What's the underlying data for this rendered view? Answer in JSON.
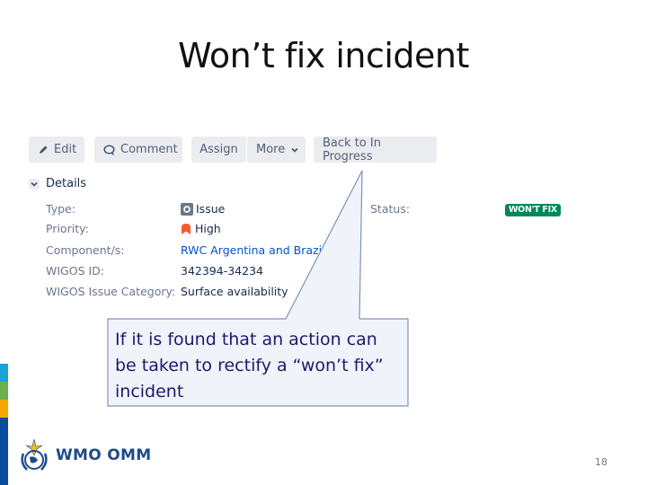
{
  "slide": {
    "title": "Won’t fix incident",
    "page_number": "18"
  },
  "toolbar": {
    "edit_label": "Edit",
    "comment_label": "Comment",
    "assign_label": "Assign",
    "more_label": "More",
    "back_label": "Back to In Progress"
  },
  "details": {
    "section_label": "Details",
    "fields": [
      {
        "label": "Type:",
        "value": "Issue",
        "icon": "issue-type-icon"
      },
      {
        "label": "Priority:",
        "value": "High",
        "icon": "priority-high-icon"
      },
      {
        "label": "Component/s:",
        "value": "RWC Argentina and Brazil"
      },
      {
        "label": "WIGOS ID:",
        "value": "342394-34234"
      },
      {
        "label": "WIGOS Issue Category:",
        "value": "Surface availability"
      }
    ],
    "status_label": "Status:",
    "status_value": "WON'T FIX",
    "status_color": "#00875a"
  },
  "callout": {
    "text": "If it is found that an action can be taken to rectify a “won’t fix” incident",
    "fill": "#f0f4fa",
    "border": "#7f93b5"
  },
  "branding": {
    "logo_text": "WMO OMM",
    "stripe_colors": [
      "#1aa3d9",
      "#6ab04c",
      "#f5a700",
      "#0a4a9c"
    ]
  }
}
